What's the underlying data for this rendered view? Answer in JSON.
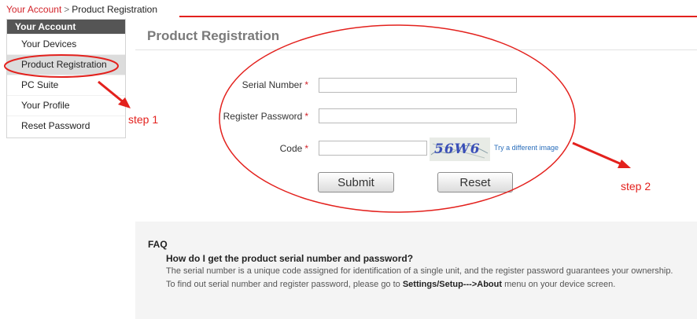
{
  "breadcrumb": {
    "account_link": "Your Account",
    "separator": ">",
    "current": "Product Registration"
  },
  "sidebar": {
    "header": "Your Account",
    "items": [
      {
        "label": "Your Devices"
      },
      {
        "label": "Product Registration",
        "active": true
      },
      {
        "label": "PC Suite"
      },
      {
        "label": "Your Profile"
      },
      {
        "label": "Reset Password"
      }
    ]
  },
  "main": {
    "title": "Product Registration",
    "form": {
      "serial_label": "Serial Number",
      "password_label": "Register Password",
      "code_label": "Code",
      "required_mark": "*",
      "serial_value": "",
      "password_value": "",
      "code_value": "",
      "captcha_text": "56W6",
      "try_different": "Try a different image",
      "submit_label": "Submit",
      "reset_label": "Reset"
    }
  },
  "faq": {
    "title": "FAQ",
    "question": "How do I get the product serial number and password?",
    "answer": "The serial number is a unique code assigned for identification of a single unit, and the register password guarantees your ownership.",
    "hint_prefix": "To find out serial number and register password, please go to ",
    "hint_bold": "Settings/Setup--->About",
    "hint_suffix": " menu on your device screen."
  },
  "annotations": {
    "step1": "step 1",
    "step2": "step 2"
  },
  "colors": {
    "accent_red": "#e3211d",
    "link_red": "#d2232a",
    "link_blue": "#2a6ebb",
    "sidebar_header": "#555555"
  }
}
